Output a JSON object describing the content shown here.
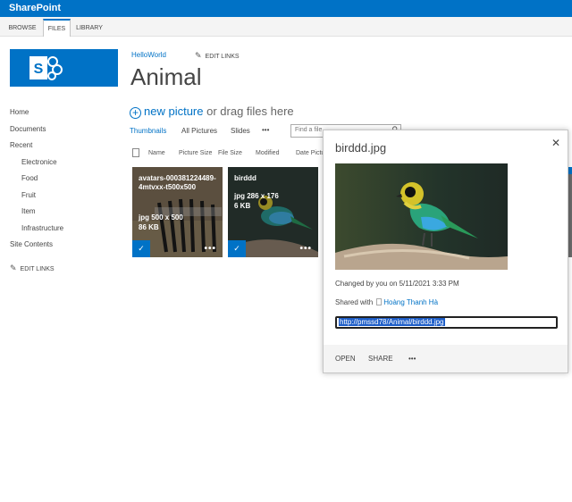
{
  "suite": {
    "title": "SharePoint"
  },
  "ribbon": {
    "tabs": [
      "BROWSE",
      "FILES",
      "LIBRARY"
    ]
  },
  "site": {
    "breadcrumb": "HelloWorld",
    "edit_links": "EDIT LINKS",
    "title": "Animal"
  },
  "quicklaunch": {
    "items": [
      "Home",
      "Documents",
      "Recent"
    ],
    "recent": [
      "Electronice",
      "Food",
      "Fruit",
      "Item",
      "Infrastructure"
    ],
    "site_contents": "Site Contents",
    "edit_links": "EDIT LINKS"
  },
  "toolbar": {
    "new_link": "new picture",
    "new_rest": "or drag files here"
  },
  "views": {
    "tabs": [
      "Thumbnails",
      "All Pictures",
      "Slides"
    ],
    "more": "•••",
    "search_placeholder": "Find a file"
  },
  "columns": [
    "Name",
    "Picture Size",
    "File Size",
    "Modified",
    "Date Pictu"
  ],
  "tiles": [
    {
      "title": "avatars-000381224489-4mtvxx-t500x500",
      "type_size": "jpg 500 x 500",
      "file_size": "86 KB"
    },
    {
      "title": "birddd",
      "type_size": "jpg 286 x 176",
      "file_size": "6 KB"
    }
  ],
  "callout": {
    "title": "birddd.jpg",
    "changed": "Changed by you on 5/11/2021 3:33 PM",
    "shared_label": "Shared with",
    "shared_person": "Hoàng Thanh Hà",
    "url": "http://pmssd78/Animal/birddd.jpg",
    "actions": [
      "OPEN",
      "SHARE",
      "•••"
    ]
  },
  "colors": {
    "accent": "#0072c6"
  }
}
